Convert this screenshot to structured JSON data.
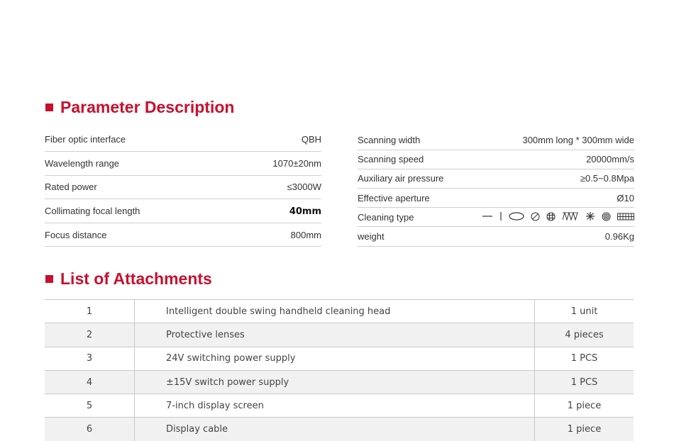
{
  "sections": {
    "params_title": "Parameter Description",
    "attach_title": "List of Attachments"
  },
  "params_left": [
    {
      "label": "Fiber optic interface",
      "value": "QBH"
    },
    {
      "label": "Wavelength range",
      "value": "1070±20nm"
    },
    {
      "label": "Rated power",
      "value": "≤3000W"
    },
    {
      "label": "Collimating focal length",
      "value": "40mm"
    },
    {
      "label": "Focus distance",
      "value": "800mm"
    }
  ],
  "params_right": [
    {
      "label": "Scanning width",
      "value": "300mm long * 300mm wide"
    },
    {
      "label": "Scanning speed",
      "value": "20000mm/s"
    },
    {
      "label": "Auxiliary air pressure",
      "value": "≥0.5~0.8Mpa"
    },
    {
      "label": "Effective aperture",
      "value": "Ø10"
    },
    {
      "label": "Cleaning type",
      "value_icons": [
        "line-pattern-icon",
        "vertical-line-pattern-icon",
        "ellipse-pattern-icon",
        "hatched-circle-pattern-icon",
        "grid-circle-pattern-icon",
        "zigzag-pattern-icon",
        "star-pattern-icon",
        "spiral-pattern-icon",
        "mesh-pattern-icon"
      ]
    },
    {
      "label": "weight",
      "value": "0.96Kg"
    }
  ],
  "attachments": [
    {
      "no": "1",
      "name": "Intelligent double swing handheld cleaning head",
      "qty": "1 unit"
    },
    {
      "no": "2",
      "name": "Protective lenses",
      "qty": "4 pieces"
    },
    {
      "no": "3",
      "name": "24V switching power supply",
      "qty": "1 PCS"
    },
    {
      "no": "4",
      "name": "±15V switch power supply",
      "qty": "1 PCS"
    },
    {
      "no": "5",
      "name": "7-inch display screen",
      "qty": "1 piece"
    },
    {
      "no": "6",
      "name": "Display cable",
      "qty": "1 piece"
    }
  ],
  "colors": {
    "accent": "#c8102e",
    "row_shade": "#f1f1f1",
    "rule": "#cfcfcf"
  }
}
